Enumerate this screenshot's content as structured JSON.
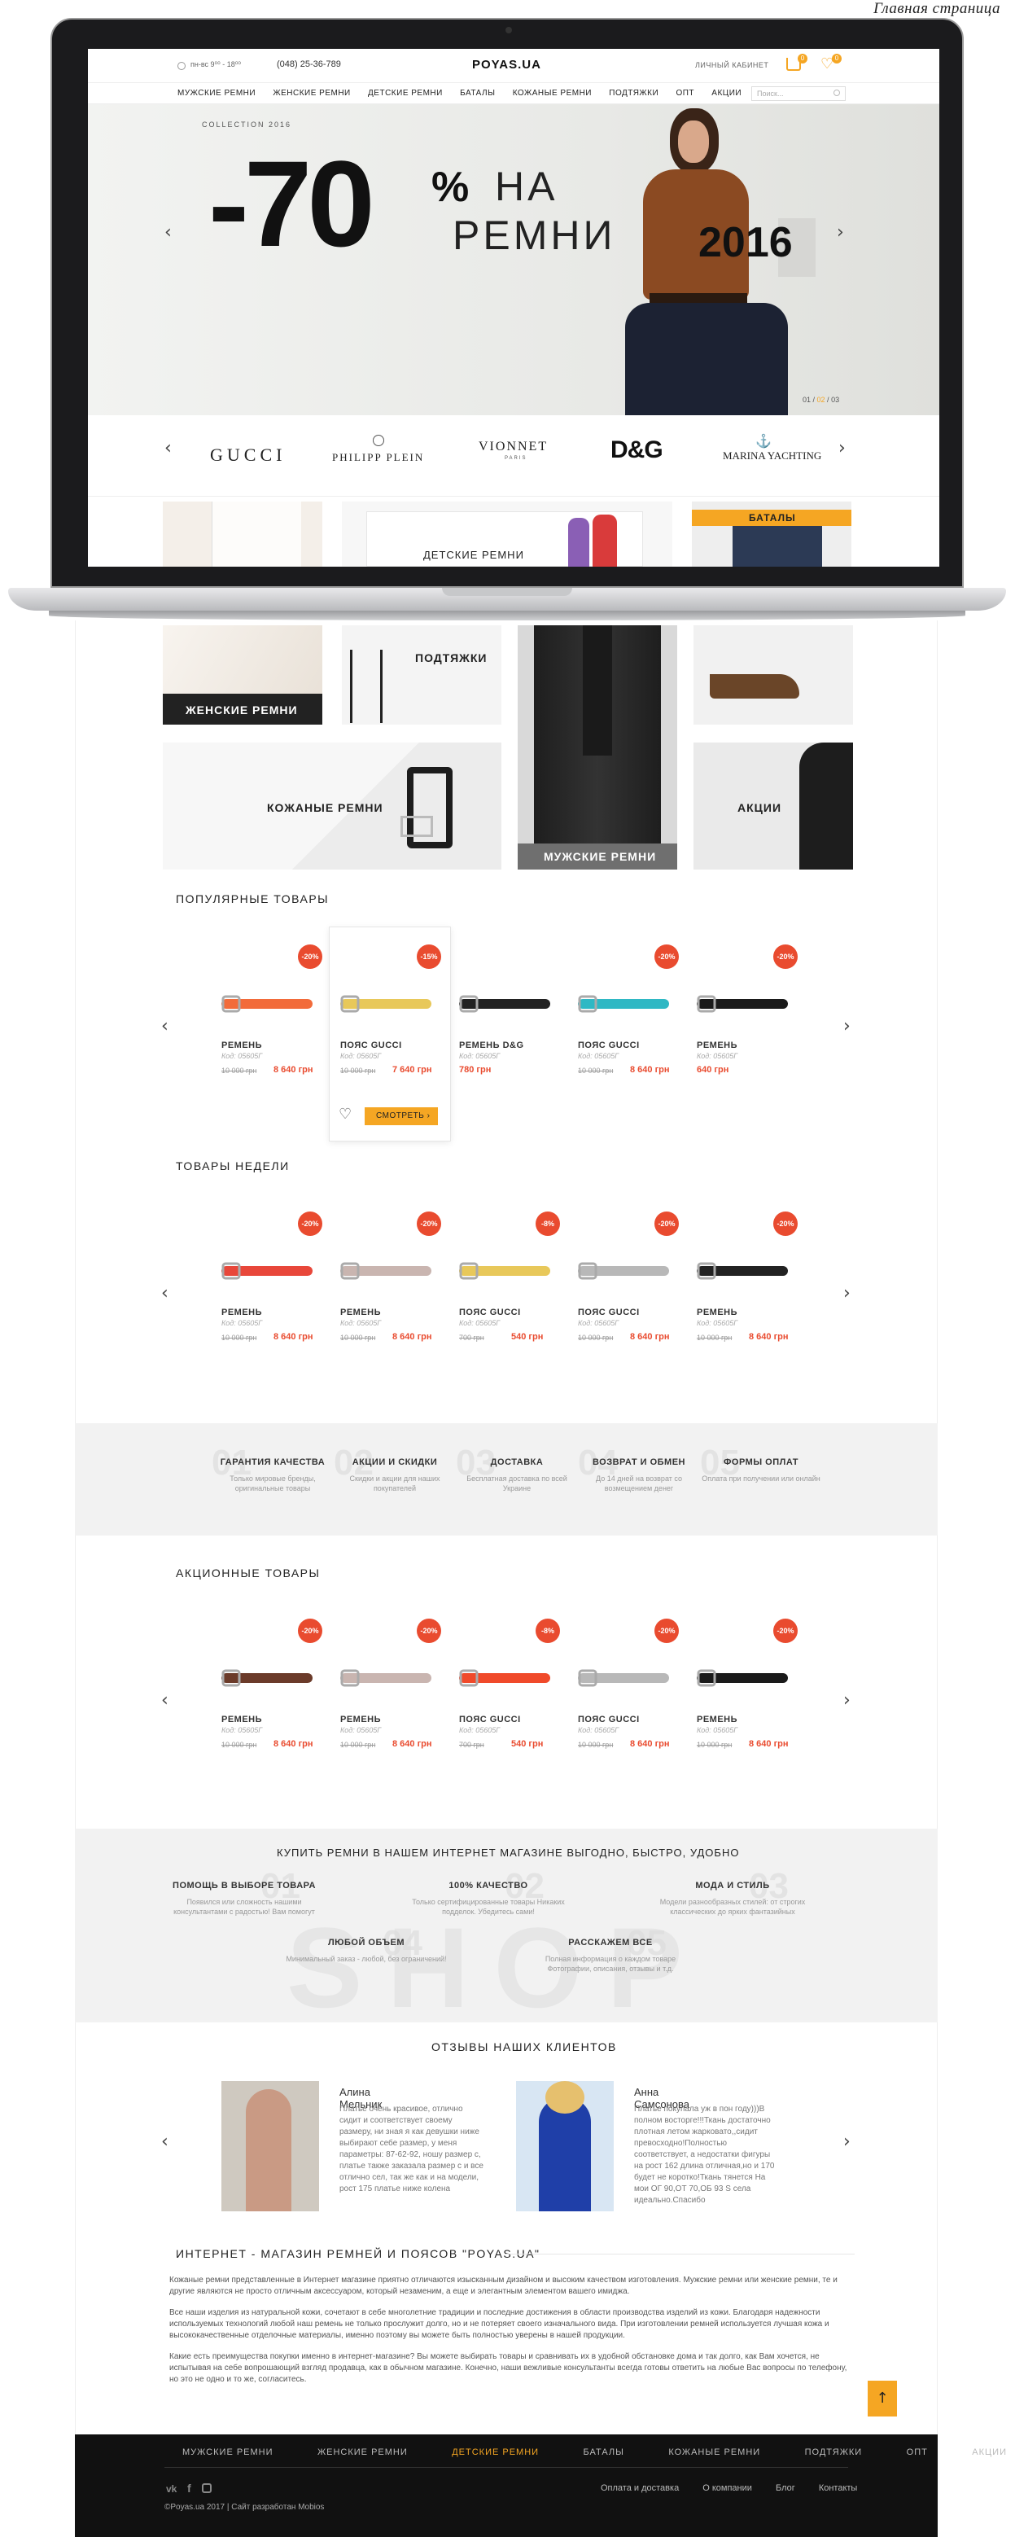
{
  "caption": "Главная страница",
  "header": {
    "phone_hours": "пн-вс 9⁰⁰ - 18⁰⁰",
    "phone": "(048) 25-36-789",
    "logo": "POYAS.UA",
    "cabinet": "ЛИЧНЫЙ КАБИНЕТ",
    "cart_count": "0",
    "wish_count": "0",
    "search_placeholder": "Поиск...",
    "nav": [
      "МУЖСКИЕ РЕМНИ",
      "ЖЕНСКИЕ РЕМНИ",
      "ДЕТСКИЕ РЕМНИ",
      "БАТАЛЫ",
      "КОЖАНЫЕ РЕМНИ",
      "ПОДТЯЖКИ",
      "ОПТ",
      "АКЦИИ"
    ]
  },
  "hero": {
    "collection": "COLLECTION 2016",
    "discount": "-70",
    "percent": "%",
    "line1": "НА",
    "line2": "РЕМНИ",
    "year": "2016",
    "pager": [
      "01",
      "02",
      "03"
    ]
  },
  "brands": [
    "GUCCI",
    "PHILIPP PLEIN",
    "VIONNET",
    "D&G",
    "MARINA YACHTING"
  ],
  "brand_sub": "PARIS",
  "categories": {
    "women": "ЖЕНСКИЕ РЕМНИ",
    "kids": "ДЕТСКИЕ РЕМНИ",
    "batal": "БАТАЛЫ",
    "suspenders": "ПОДТЯЖКИ",
    "leather": "КОЖАНЫЕ РЕМНИ",
    "men": "МУЖСКИЕ РЕМНИ",
    "sale": "АКЦИИ"
  },
  "popular": {
    "title": "ПОПУЛЯРНЫЕ ТОВАРЫ",
    "items": [
      {
        "badge": "-20%",
        "name": "РЕМЕНЬ",
        "code": "Код: 05605Г",
        "old": "10 000 грн",
        "price": "8 640 грн",
        "color": "#f26b3a"
      },
      {
        "badge": "-15%",
        "name": "ПОЯС GUCCI",
        "code": "Код: 05605Г",
        "old": "10 000 грн",
        "price": "7 640 грн",
        "color": "#e8c85a"
      },
      {
        "badge": "",
        "name": "РЕМЕНЬ D&G",
        "code": "Код: 05605Г",
        "old": "",
        "price": "780 грн",
        "color": "#222222"
      },
      {
        "badge": "-20%",
        "name": "ПОЯС GUCCI",
        "code": "Код: 05605Г",
        "old": "10 000 грн",
        "price": "8 640 грн",
        "color": "#2fb8c4"
      },
      {
        "badge": "-20%",
        "name": "РЕМЕНЬ",
        "code": "Код: 05605Г",
        "old": "",
        "price": "640 грн",
        "color": "#1a1a1a"
      }
    ],
    "see_btn": "СМОТРЕТЬ"
  },
  "week": {
    "title": "ТОВАРЫ НЕДЕЛИ",
    "items": [
      {
        "badge": "-20%",
        "name": "РЕМЕНЬ",
        "code": "Код: 05605Г",
        "old": "10 000 грн",
        "price": "8 640 грн",
        "color": "#e8473a"
      },
      {
        "badge": "-20%",
        "name": "РЕМЕНЬ",
        "code": "Код: 05605Г",
        "old": "10 000 грн",
        "price": "8 640 грн",
        "color": "#c9b5b0"
      },
      {
        "badge": "-8%",
        "name": "ПОЯС GUCCI",
        "code": "Код: 05605Г",
        "old": "700 грн",
        "price": "540 грн",
        "color": "#e8c85a"
      },
      {
        "badge": "-20%",
        "name": "ПОЯС GUCCI",
        "code": "Код: 05605Г",
        "old": "10 000 грн",
        "price": "8 640 грн",
        "color": "#b8b8b8"
      },
      {
        "badge": "-20%",
        "name": "РЕМЕНЬ",
        "code": "Код: 05605Г",
        "old": "10 000 грн",
        "price": "8 640 грн",
        "color": "#222222"
      }
    ]
  },
  "features": [
    {
      "num": "01",
      "title": "ГАРАНТИЯ КАЧЕСТВА",
      "desc": "Только мировые бренды, оригинальные товары"
    },
    {
      "num": "02",
      "title": "АКЦИИ И СКИДКИ",
      "desc": "Скидки и акции для наших покупателей"
    },
    {
      "num": "03",
      "title": "ДОСТАВКА",
      "desc": "Бесплатная доставка по всей Украине"
    },
    {
      "num": "04",
      "title": "ВОЗВРАТ И ОБМЕН",
      "desc": "До 14 дней на возврат со возмещением денег"
    },
    {
      "num": "05",
      "title": "ФОРМЫ ОПЛАТ",
      "desc": "Оплата при получении или онлайн"
    }
  ],
  "promo": {
    "title": "АКЦИОННЫЕ ТОВАРЫ",
    "items": [
      {
        "badge": "-20%",
        "name": "РЕМЕНЬ",
        "code": "Код: 05605Г",
        "old": "10 000 грн",
        "price": "8 640 грн",
        "color": "#6b3b2a"
      },
      {
        "badge": "-20%",
        "name": "РЕМЕНЬ",
        "code": "Код: 05605Г",
        "old": "10 000 грн",
        "price": "8 640 грн",
        "color": "#c9b5b0"
      },
      {
        "badge": "-8%",
        "name": "ПОЯС GUCCI",
        "code": "Код: 05605Г",
        "old": "700 грн",
        "price": "540 грн",
        "color": "#f04a2a"
      },
      {
        "badge": "-20%",
        "name": "ПОЯС GUCCI",
        "code": "Код: 05605Г",
        "old": "10 000 грн",
        "price": "8 640 грн",
        "color": "#b8b8b8"
      },
      {
        "badge": "-20%",
        "name": "РЕМЕНЬ",
        "code": "Код: 05605Г",
        "old": "10 000 грн",
        "price": "8 640 грн",
        "color": "#1a1a1a"
      }
    ]
  },
  "why": {
    "title": "КУПИТЬ РЕМНИ В НАШЕМ ИНТЕРНЕТ МАГАЗИНЕ ВЫГОДНО, БЫСТРО, УДОБНО",
    "bg_word": "SHOP",
    "items": [
      {
        "num": "01",
        "title": "ПОМОЩЬ В ВЫБОРЕ ТОВАРА",
        "desc": "Появился или сложность нашими консультантами с радостью! Вам помогут"
      },
      {
        "num": "02",
        "title": "100% КАЧЕСТВО",
        "desc": "Только сертифицированные товары Никаких подделок. Убедитесь сами!"
      },
      {
        "num": "03",
        "title": "МОДА И СТИЛЬ",
        "desc": "Модели разнообразных стилей: от строгих классических до ярких фантазийных"
      },
      {
        "num": "04",
        "title": "ЛЮБОЙ ОБЪЕМ",
        "desc": "Минимальный заказ - любой, без ограничений!"
      },
      {
        "num": "05",
        "title": "РАССКАЖЕМ ВСЕ",
        "desc": "Полная информация о каждом товаре Фотографии, описания, отзывы и т.д."
      }
    ]
  },
  "reviews": {
    "title": "ОТЗЫВЫ НАШИХ КЛИЕНТОВ",
    "items": [
      {
        "name": "Алина Мельник",
        "text": "Платье очень красивое, отлично сидит и соответствует своему размеру, ни зная я как девушки ниже выбирают себе размер, у меня параметры: 87-62-92, ношу размер с, платье также заказала размер с и все отлично сел, так же как и на модели, рост 175 платье ниже колена"
      },
      {
        "name": "Анна Самсонова",
        "text": "Платье покупала уж в пон году)))В полном восторге!!!Ткань достаточно плотная летом жарковато,,сидит превосходно!Полностью соответствует, а недостатки фигуры на рост 162 длина отличная,но и 170 будет не коротко!Ткань тянется На мои ОГ 90,ОТ 70,ОБ 93 S села идеально.Спасибо"
      }
    ]
  },
  "about": {
    "title": "ИНТЕРНЕТ - МАГАЗИН РЕМНЕЙ И ПОЯСОВ \"POYAS.UA\"",
    "p1": "Кожаные ремни представленные в Интернет магазине приятно отличаются изысканным дизайном и высоким качеством изготовления. Мужские ремни или женские ремни, те и другие являются не просто отличным аксессуаром, который незаменим, а еще и элегантным элементом вашего имиджа.",
    "p2": "Все наши изделия из натуральной кожи, сочетают в себе многолетние традиции и последние достижения в области производства изделий из кожи. Благодаря надежности используемых технологий любой наш ремень не только прослужит долго, но и не потеряет своего изначального вида. При изготовлении ремней используется лучшая кожа и высококачественные отделочные материалы, именно поэтому вы можете быть полностью уверены в нашей продукции.",
    "p3": "Какие есть преимущества покупки именно в интернет-магазине? Вы можете выбирать товары и сравнивать их в удобной обстановке дома и так долго, как Вам хочется, не испытывая на себе вопрошающий взгляд продавца, как в обычном магазине. Конечно, наши вежливые консультанты всегда готовы ответить на любые Вас вопросы по телефону, но это не одно и то же, согласитесь."
  },
  "footer": {
    "nav": [
      "МУЖСКИЕ РЕМНИ",
      "ЖЕНСКИЕ РЕМНИ",
      "ДЕТСКИЕ РЕМНИ",
      "БАТАЛЫ",
      "КОЖАНЫЕ РЕМНИ",
      "ПОДТЯЖКИ",
      "ОПТ",
      "АКЦИИ"
    ],
    "links": [
      "Оплата и доставка",
      "О компании",
      "Блог",
      "Контакты"
    ],
    "copyright": "©Poyas.ua 2017 | Сайт разработан Mobios",
    "socials": [
      "vk-icon",
      "facebook-icon",
      "instagram-icon"
    ]
  },
  "colors": {
    "accent": "#f5a623",
    "sale": "#e94b2f",
    "dark": "#111111"
  }
}
